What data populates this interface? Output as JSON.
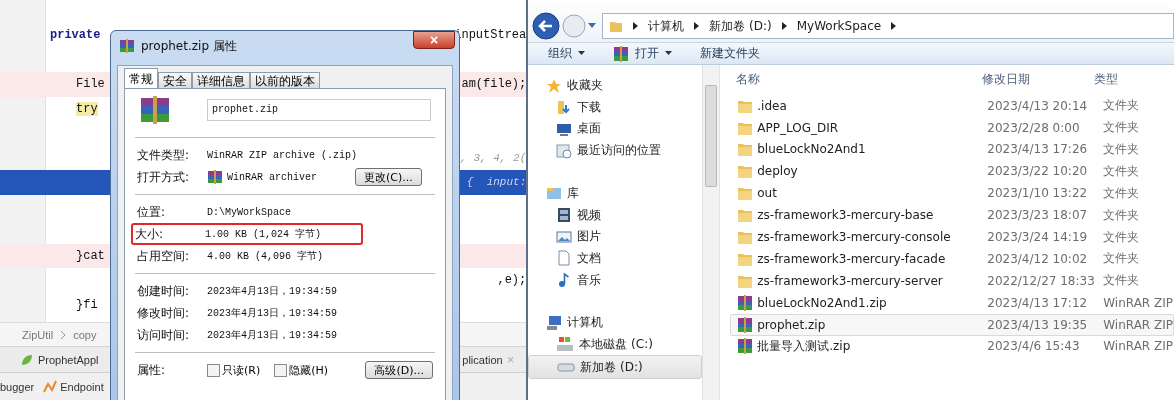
{
  "ide": {
    "signature": {
      "left": "private",
      "right": "inputStrea"
    },
    "code_lines": [
      {
        "kind": "plain"
      },
      {
        "kind": "error",
        "left": "File",
        "right": "am(file);"
      },
      {
        "kind": "match",
        "left": "try"
      },
      {
        "kind": "plain"
      },
      {
        "kind": "hint",
        "right": ", 3, 4, 2("
      },
      {
        "kind": "current",
        "right": "{  input:"
      },
      {
        "kind": "plain"
      },
      {
        "kind": "plain"
      },
      {
        "kind": "error",
        "left": "}cat"
      },
      {
        "kind": "plain",
        "right": ",e);"
      },
      {
        "kind": "plain",
        "left": "}fi"
      }
    ],
    "breadcrumb": [
      "ZipUtil",
      "copy"
    ],
    "run_bar": {
      "left_tab": "ProphetAppl",
      "right_tab": "plication",
      "close": "×"
    },
    "tool_tabs": [
      "bugger",
      "Endpoint"
    ]
  },
  "dialog": {
    "title": "prophet.zip 属性",
    "close": "×",
    "tabs": [
      {
        "label": "常规",
        "selected": true
      },
      {
        "label": "安全",
        "selected": false
      },
      {
        "label": "详细信息",
        "selected": false
      },
      {
        "label": "以前的版本",
        "selected": false
      }
    ],
    "file_name": "prophet.zip",
    "groups": [
      [
        {
          "label": "文件类型:",
          "value": "WinRAR ZIP archive (.zip)",
          "kind": "text",
          "highlighted": false
        },
        {
          "label": "打开方式:",
          "value": "WinRAR archiver",
          "kind": "app",
          "button": "更改(C)...",
          "highlighted": false
        }
      ],
      [
        {
          "label": "位置:",
          "value": "D:\\MyWorkSpace",
          "kind": "text",
          "highlighted": false
        },
        {
          "label": "大小:",
          "value": "1.00 KB (1,024 字节)",
          "kind": "text",
          "highlighted": true
        },
        {
          "label": "占用空间:",
          "value": "4.00 KB (4,096 字节)",
          "kind": "text",
          "highlighted": false
        }
      ],
      [
        {
          "label": "创建时间:",
          "value": "2023年4月13日，19:34:59",
          "kind": "text",
          "highlighted": false
        },
        {
          "label": "修改时间:",
          "value": "2023年4月13日，19:34:59",
          "kind": "text",
          "highlighted": false
        },
        {
          "label": "访问时间:",
          "value": "2023年4月13日，19:34:59",
          "kind": "text",
          "highlighted": false
        }
      ]
    ],
    "attributes": {
      "label": "属性:",
      "checkboxes": [
        {
          "label": "只读(R)",
          "checked": false
        },
        {
          "label": "隐藏(H)",
          "checked": false
        }
      ],
      "button": "高级(D)..."
    }
  },
  "explorer": {
    "address": [
      "计算机",
      "新加卷 (D:)",
      "MyWorkSpace"
    ],
    "toolbar": [
      {
        "label": "组织",
        "kind": "menu"
      },
      {
        "label": "打开",
        "kind": "app-menu"
      },
      {
        "label": "新建文件夹",
        "kind": "plain"
      }
    ],
    "nav": [
      {
        "label": "收藏夹",
        "kind": "star",
        "selected": false,
        "children": [
          {
            "label": "下载",
            "kind": "download",
            "selected": false
          },
          {
            "label": "桌面",
            "kind": "desktop",
            "selected": false
          },
          {
            "label": "最近访问的位置",
            "kind": "recent",
            "selected": false
          }
        ]
      },
      {
        "label": "库",
        "kind": "library",
        "selected": false,
        "children": [
          {
            "label": "视频",
            "kind": "video",
            "selected": false
          },
          {
            "label": "图片",
            "kind": "picture",
            "selected": false
          },
          {
            "label": "文档",
            "kind": "document",
            "selected": false
          },
          {
            "label": "音乐",
            "kind": "music",
            "selected": false
          }
        ]
      },
      {
        "label": "计算机",
        "kind": "computer",
        "selected": false,
        "children": [
          {
            "label": "本地磁盘 (C:)",
            "kind": "system-drive",
            "selected": false
          },
          {
            "label": "新加卷 (D:)",
            "kind": "drive",
            "selected": true
          }
        ]
      }
    ],
    "columns": [
      "名称",
      "修改日期",
      "类型"
    ],
    "rows": [
      {
        "name": ".idea",
        "date": "2023/4/13 20:14",
        "type": "文件夹",
        "kind": "folder",
        "selected": false
      },
      {
        "name": "APP_LOG_DIR",
        "date": "2023/2/28 0:00",
        "type": "文件夹",
        "kind": "folder",
        "selected": false
      },
      {
        "name": "blueLockNo2And1",
        "date": "2023/4/13 17:26",
        "type": "文件夹",
        "kind": "folder",
        "selected": false
      },
      {
        "name": "deploy",
        "date": "2023/3/22 10:20",
        "type": "文件夹",
        "kind": "folder",
        "selected": false
      },
      {
        "name": "out",
        "date": "2023/1/10 13:22",
        "type": "文件夹",
        "kind": "folder",
        "selected": false
      },
      {
        "name": "zs-framework3-mercury-base",
        "date": "2023/3/23 18:07",
        "type": "文件夹",
        "kind": "folder",
        "selected": false
      },
      {
        "name": "zs-framework3-mercury-console",
        "date": "2023/3/24 14:19",
        "type": "文件夹",
        "kind": "folder",
        "selected": false
      },
      {
        "name": "zs-framework3-mercury-facade",
        "date": "2023/4/12 10:02",
        "type": "文件夹",
        "kind": "folder",
        "selected": false
      },
      {
        "name": "zs-framework3-mercury-server",
        "date": "2022/12/27 18:33",
        "type": "文件夹",
        "kind": "folder",
        "selected": false
      },
      {
        "name": "blueLockNo2And1.zip",
        "date": "2023/4/13 17:12",
        "type": "WinRAR ZIP",
        "kind": "archive",
        "selected": false
      },
      {
        "name": "prophet.zip",
        "date": "2023/4/13 19:35",
        "type": "WinRAR ZIP",
        "kind": "archive",
        "selected": true
      },
      {
        "name": "批量导入测试.zip",
        "date": "2023/4/6 15:43",
        "type": "WinRAR ZIP",
        "kind": "archive",
        "selected": false
      }
    ]
  }
}
